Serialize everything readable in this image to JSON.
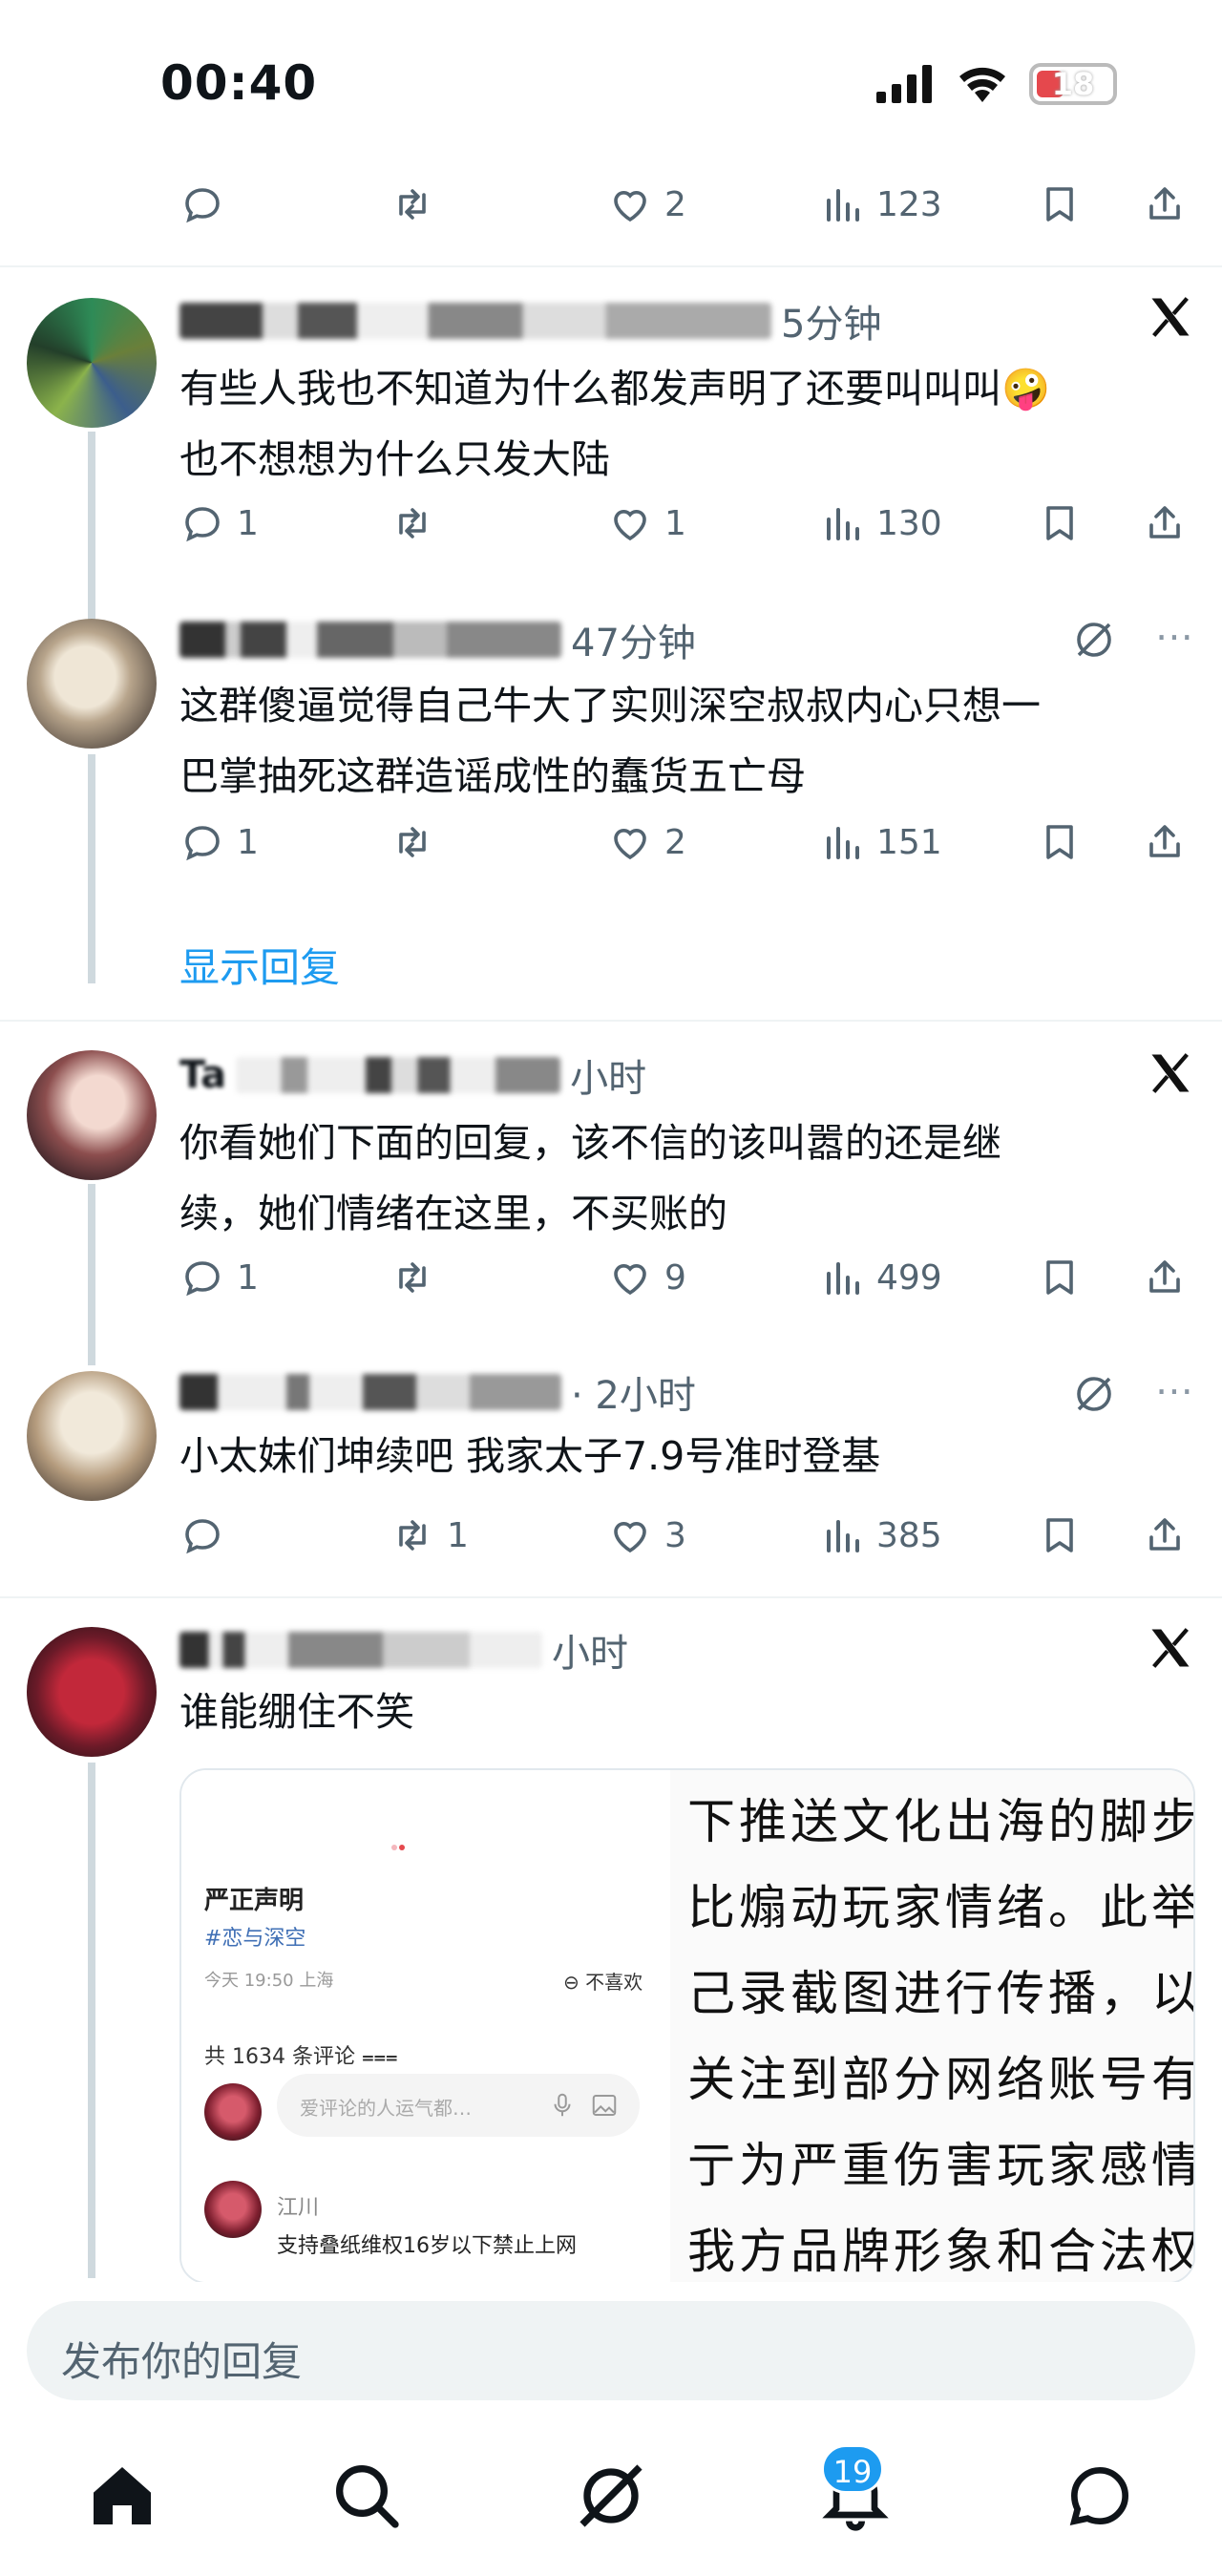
{
  "status_bar": {
    "time": "00:40",
    "battery": "18"
  },
  "top_actions": {
    "like_count": "2",
    "view_count": "123"
  },
  "posts": [
    {
      "meta": "5分钟",
      "text_line1": "有些人我也不知道为什么都发声明了还要叫叫叫🤪",
      "text_line2": "也不想想为什么只发大陆",
      "reply_count": "1",
      "retweet_count": "",
      "like_count": "1",
      "view_count": "130"
    },
    {
      "meta": "47分钟",
      "text_line1": "这群傻逼觉得自己牛大了实则深空叔叔内心只想一",
      "text_line2": "巴掌抽死这群造谣成性的蠢货五亡母",
      "reply_count": "1",
      "retweet_count": "",
      "like_count": "2",
      "view_count": "151",
      "show_replies": "显示回复"
    },
    {
      "name_prefix": "Ta",
      "meta": "小时",
      "text_line1": "你看她们下面的回复，该不信的该叫嚣的还是继",
      "text_line2": "续，她们情绪在这里，不买账的",
      "reply_count": "1",
      "retweet_count": "",
      "like_count": "9",
      "view_count": "499"
    },
    {
      "meta": "· 2小时",
      "text_line1": "小太妹们坤续吧 我家太子7.9号准时登基",
      "reply_count": "",
      "retweet_count": "1",
      "like_count": "3",
      "view_count": "385"
    },
    {
      "meta": "小时",
      "text_line1": "谁能绷住不笑"
    }
  ],
  "embed": {
    "title": "严正声明",
    "tag": "#恋与深空",
    "time": "今天 19:50 上海",
    "dislike": "⊖ 不喜欢",
    "comment_count": "共 1634 条评论 ⩶",
    "input_placeholder": "爱评论的人运气都…",
    "commenter_name": "江川",
    "comment_text": "支持叠纸维权16岁以下禁止上网",
    "right_lines": [
      "下推送文化出海的脚步",
      "比煽动玩家情绪。此举",
      "己录截图进行传播，以",
      "关注到部分网络账号有",
      "亍为严重伤害玩家感情",
      "我方品牌形象和合法权"
    ]
  },
  "composer": {
    "placeholder": "发布你的回复"
  },
  "tabbar": {
    "notification_badge": "19"
  },
  "colors": {
    "accent": "#1d9bf0",
    "muted": "#536471",
    "divider": "#eff3f4"
  }
}
